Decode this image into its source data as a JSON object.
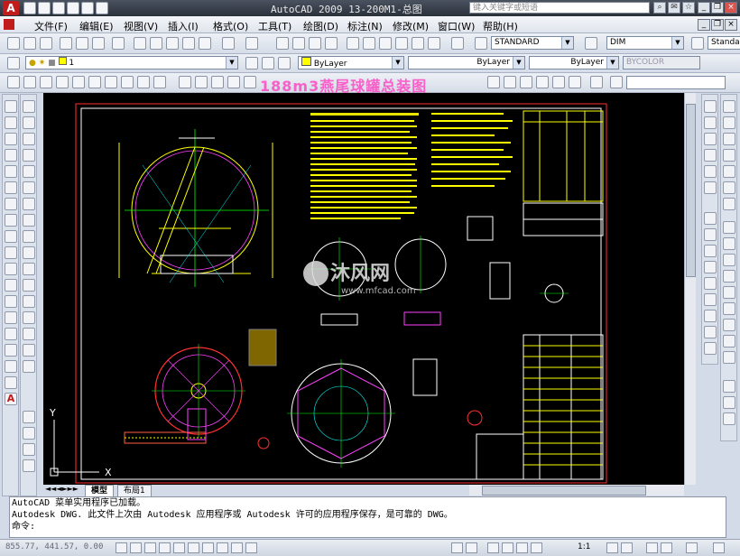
{
  "app": {
    "title": "AutoCAD 2009  13-200M1-总图",
    "search_placeholder": "键入关键字或短语"
  },
  "menu": [
    "文件(F)",
    "编辑(E)",
    "视图(V)",
    "插入(I)",
    "格式(O)",
    "工具(T)",
    "绘图(D)",
    "标注(N)",
    "修改(M)",
    "窗口(W)",
    "帮助(H)"
  ],
  "styles": {
    "text_style": "STANDARD",
    "dim_style": "DIM",
    "table_style": "Standar"
  },
  "layers": {
    "current_layer": "1",
    "color": "ByLayer",
    "linetype": "ByLayer",
    "lineweight": "ByLayer",
    "plot_style": "BYCOLOR"
  },
  "drawing": {
    "overlay_title": "188m3燕尾球罐总装图",
    "watermark_site": "www.mfcad.com",
    "ucs_x": "X",
    "ucs_y": "Y"
  },
  "tabs": [
    "模型",
    "布局1"
  ],
  "command": {
    "lines": [
      "AutoCAD 菜单实用程序已加载。",
      "Autodesk DWG.   此文件上次由 Autodesk 应用程序或 Autodesk 许可的应用程序保存，是可靠的 DWG。",
      "命令:"
    ]
  },
  "status": {
    "coordinates": "855.77, 441.57, 0.00",
    "scale": "1:1"
  }
}
